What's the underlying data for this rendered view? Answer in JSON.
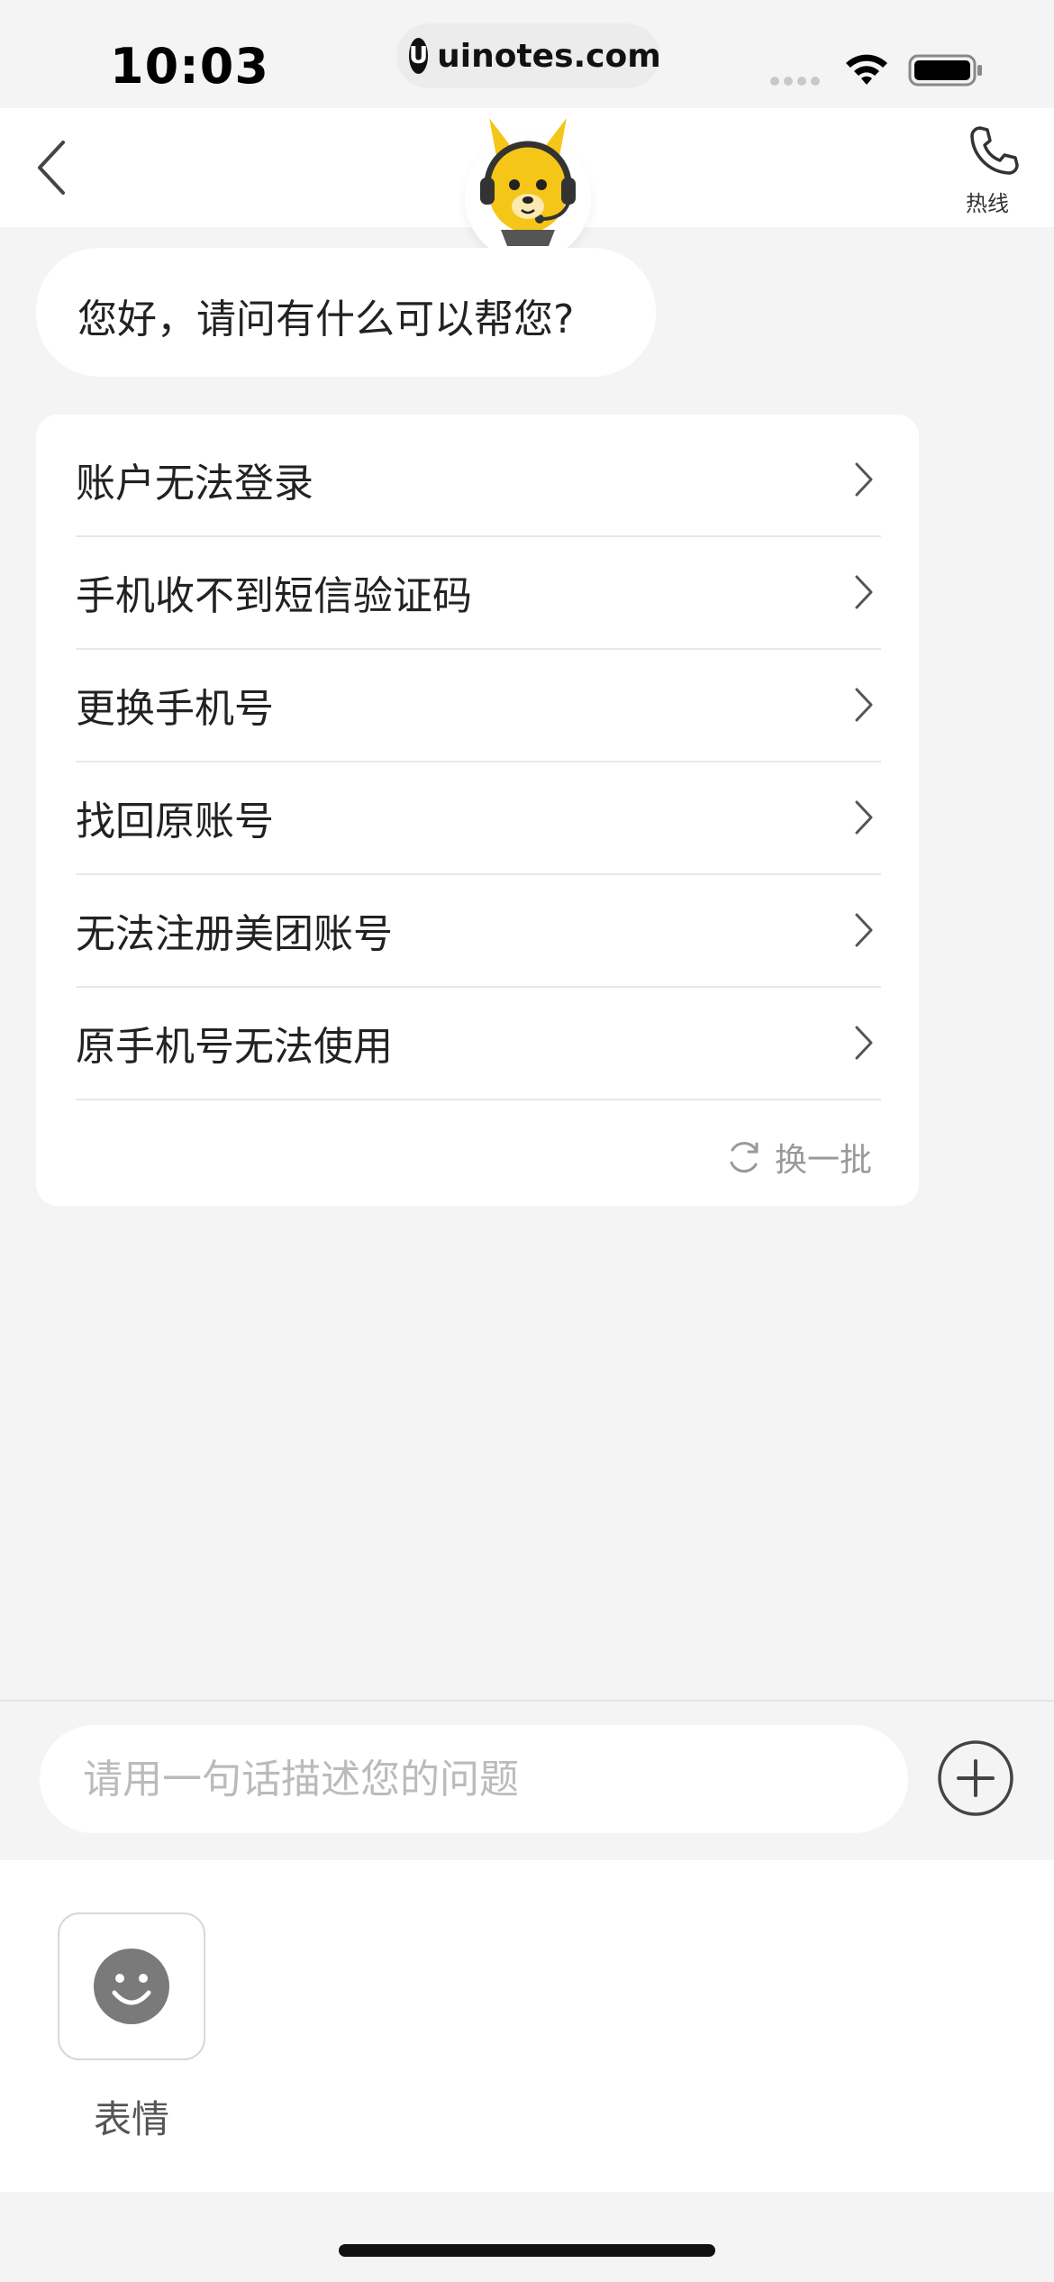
{
  "status_bar": {
    "time": "10:03",
    "url": "uinotes.com",
    "url_logo": "U"
  },
  "nav": {
    "back_icon": "chevron-left-icon",
    "hotline_label": "热线",
    "hotline_icon": "phone-icon"
  },
  "chat": {
    "greeting": "您好，请问有什么可以帮您?"
  },
  "menu": {
    "items": [
      {
        "label": "账户无法登录"
      },
      {
        "label": "手机收不到短信验证码"
      },
      {
        "label": "更换手机号"
      },
      {
        "label": "找回原账号"
      },
      {
        "label": "无法注册美团账号"
      },
      {
        "label": "原手机号无法使用"
      }
    ],
    "refresh_label": "换一批"
  },
  "input": {
    "placeholder": "请用一句话描述您的问题"
  },
  "panel": {
    "emoji_label": "表情"
  },
  "colors": {
    "background": "#f4f4f4",
    "card": "#ffffff",
    "mascot_yellow": "#f5c518",
    "muted_text": "#999999"
  }
}
